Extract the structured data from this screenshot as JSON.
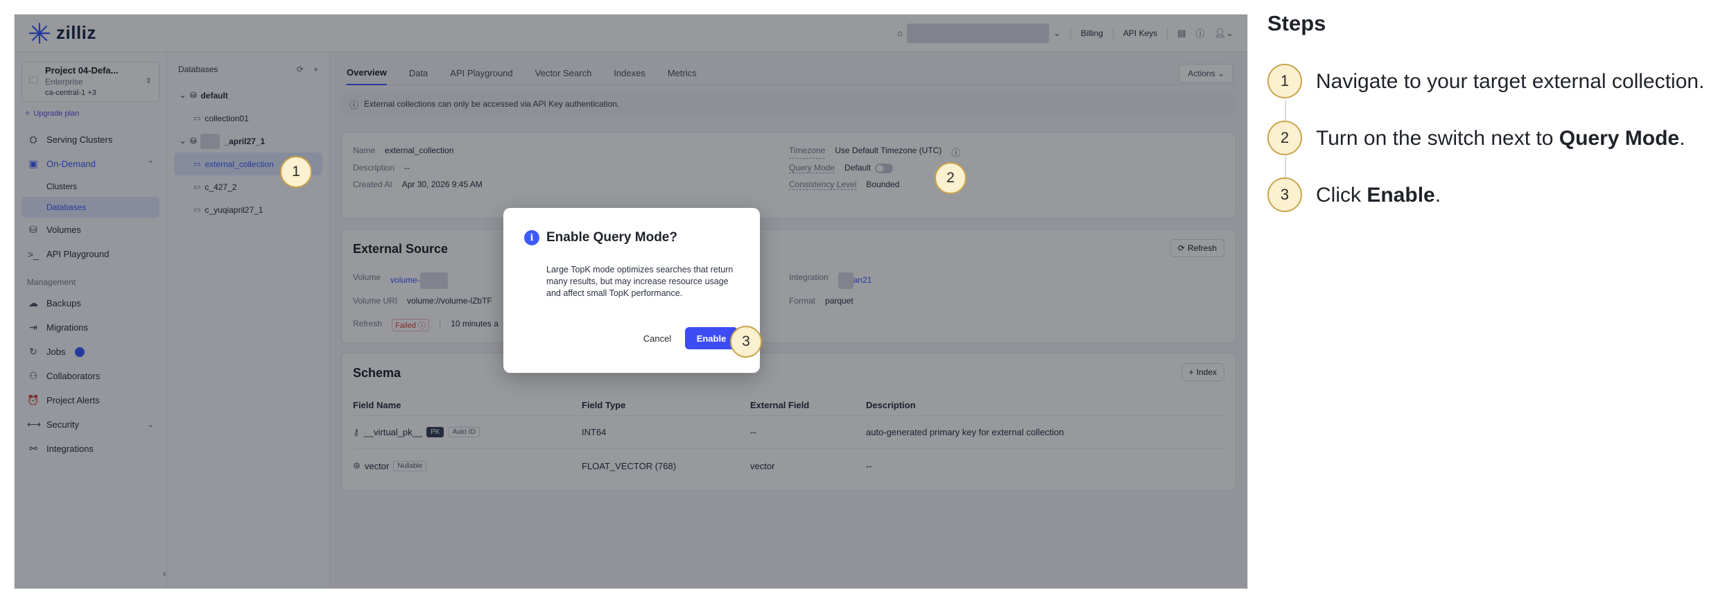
{
  "app": {
    "logo_text": "zilliz",
    "topbar": {
      "billing": "Billing",
      "api_keys": "API Keys"
    },
    "sidebar": {
      "project_name": "Project 04-Defa...",
      "project_plan": "Enterprise",
      "project_region": "ca-central-1 +3",
      "upgrade": "Upgrade plan",
      "items": {
        "serving_clusters": "Serving Clusters",
        "on_demand": "On-Demand",
        "clusters": "Clusters",
        "databases": "Databases",
        "volumes": "Volumes",
        "api_playground": "API Playground"
      },
      "management_label": "Management",
      "management": {
        "backups": "Backups",
        "migrations": "Migrations",
        "jobs": "Jobs",
        "collaborators": "Collaborators",
        "project_alerts": "Project Alerts",
        "security": "Security",
        "integrations": "Integrations"
      }
    },
    "dbpanel": {
      "title": "Databases",
      "db_default": "default",
      "col_collection01": "collection01",
      "db_april": "_april27_1",
      "col_external": "external_collection",
      "col_c427": "c_427_2",
      "col_yuqi": "c_yuqiapril27_1"
    },
    "tabs": {
      "overview": "Overview",
      "data": "Data",
      "api_playground": "API Playground",
      "vector_search": "Vector Search",
      "indexes": "Indexes",
      "metrics": "Metrics",
      "actions": "Actions"
    },
    "banner": "External collections can only be accessed via API Key authentication.",
    "overview": {
      "name_k": "Name",
      "name_v": "external_collection",
      "desc_k": "Description",
      "desc_v": "--",
      "created_k": "Created At",
      "created_v": "Apr 30, 2026 9:45 AM",
      "tz_k": "Timezone",
      "tz_v": "Use Default Timezone (UTC)",
      "qm_k": "Query Mode",
      "qm_v": "Default",
      "cl_k": "Consistency Level",
      "cl_v": "Bounded"
    },
    "source": {
      "title": "External Source",
      "refresh_btn": "Refresh",
      "volume_k": "Volume",
      "volume_v": "volume-",
      "uri_k": "Volume URI",
      "uri_v": "volume://volume-lZbTF",
      "refresh_k": "Refresh",
      "refresh_status": "Failed",
      "refresh_time": "10 minutes a",
      "integration_k": "Integration",
      "integration_v": "an21",
      "format_k": "Format",
      "format_v": "parquet"
    },
    "schema": {
      "title": "Schema",
      "index_btn": "Index",
      "headers": {
        "name": "Field Name",
        "type": "Field Type",
        "external": "External Field",
        "desc": "Description"
      },
      "rows": [
        {
          "name": "__virtual_pk__",
          "tag1": "PK",
          "tag2": "Auto ID",
          "type": "INT64",
          "external": "--",
          "desc": "auto-generated primary key for external collection"
        },
        {
          "name": "vector",
          "tag1": "Nullable",
          "type": "FLOAT_VECTOR (768)",
          "external": "vector",
          "desc": "--"
        }
      ]
    },
    "modal": {
      "title": "Enable Query Mode?",
      "body": "Large TopK mode optimizes searches that return many results, but may increase resource usage and affect small TopK performance.",
      "cancel": "Cancel",
      "enable": "Enable"
    },
    "markers": {
      "m1": "1",
      "m2": "2",
      "m3": "3"
    }
  },
  "steps": {
    "title": "Steps",
    "items": [
      {
        "num": "1",
        "text": "Navigate to your target external collection."
      },
      {
        "num": "2",
        "pre": "Turn on the switch next to ",
        "bold": "Query Mode",
        "post": "."
      },
      {
        "num": "3",
        "pre": "Click ",
        "bold": "Enable",
        "post": "."
      }
    ]
  },
  "colors": {
    "accent": "#3d5afe",
    "enable_button": "#3d4cf2",
    "marker_fill": "#fbf0d0",
    "marker_border": "#c9a44a",
    "failed": "#e0453a"
  }
}
